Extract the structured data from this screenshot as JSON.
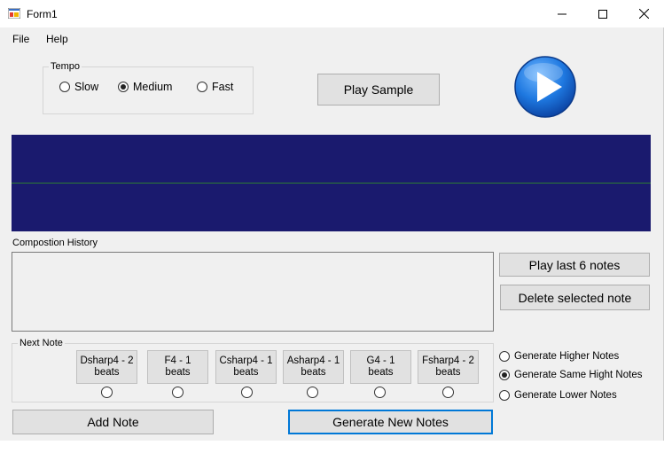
{
  "window": {
    "title": "Form1",
    "minimize_icon": "minimize-icon",
    "maximize_icon": "maximize-icon",
    "close_icon": "close-icon"
  },
  "menu": {
    "items": [
      "File",
      "Help"
    ]
  },
  "tempo": {
    "label": "Tempo",
    "options": [
      {
        "label": "Slow",
        "checked": false
      },
      {
        "label": "Medium",
        "checked": true
      },
      {
        "label": "Fast",
        "checked": false
      }
    ]
  },
  "play_sample_label": "Play Sample",
  "play_icon": "play-icon",
  "colors": {
    "waveform_bg": "#1a1a6e",
    "waveform_line": "#2e7d32",
    "accent": "#0078d7"
  },
  "history": {
    "label": "Compostion History"
  },
  "buttons": {
    "play_last": "Play last 6 notes",
    "delete_selected": "Delete selected note",
    "add_note": "Add Note",
    "generate_new": "Generate New Notes"
  },
  "next_note": {
    "label": "Next Note",
    "notes": [
      {
        "line1": "Dsharp4 - 2",
        "line2": "beats"
      },
      {
        "line1": "F4 - 1",
        "line2": "beats"
      },
      {
        "line1": "Csharp4 - 1",
        "line2": "beats"
      },
      {
        "line1": "Asharp4 - 1",
        "line2": "beats"
      },
      {
        "line1": "G4 - 1",
        "line2": "beats"
      },
      {
        "line1": "Fsharp4 - 2",
        "line2": "beats"
      }
    ]
  },
  "generate_options": [
    {
      "label": "Generate Higher Notes",
      "checked": false
    },
    {
      "label": "Generate Same Hight Notes",
      "checked": true
    },
    {
      "label": "Generate Lower Notes",
      "checked": false
    }
  ]
}
